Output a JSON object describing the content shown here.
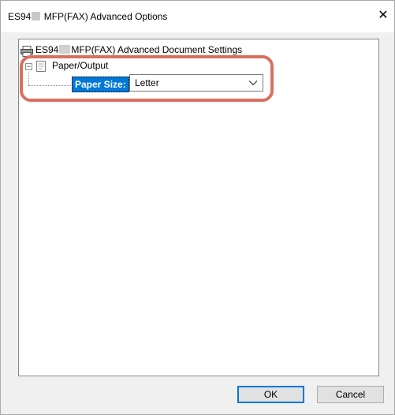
{
  "window": {
    "title_prefix": "ES94",
    "title_suffix": "MFP(FAX) Advanced Options",
    "close_glyph": "✕"
  },
  "tree": {
    "root_prefix": "ES94",
    "root_suffix": "MFP(FAX) Advanced Document Settings",
    "root_icon": "printer-icon",
    "node": {
      "expander": "−",
      "icon": "paper-output-icon",
      "label": "Paper/Output"
    },
    "setting": {
      "label": "Paper Size:",
      "value": "Letter",
      "dropdown_icon": "chevron-down-icon"
    }
  },
  "buttons": {
    "ok": "OK",
    "cancel": "Cancel"
  },
  "colors": {
    "selection": "#0078d7",
    "highlight_annotation": "#d9705e",
    "dialog_bg": "#f0f0f0"
  }
}
